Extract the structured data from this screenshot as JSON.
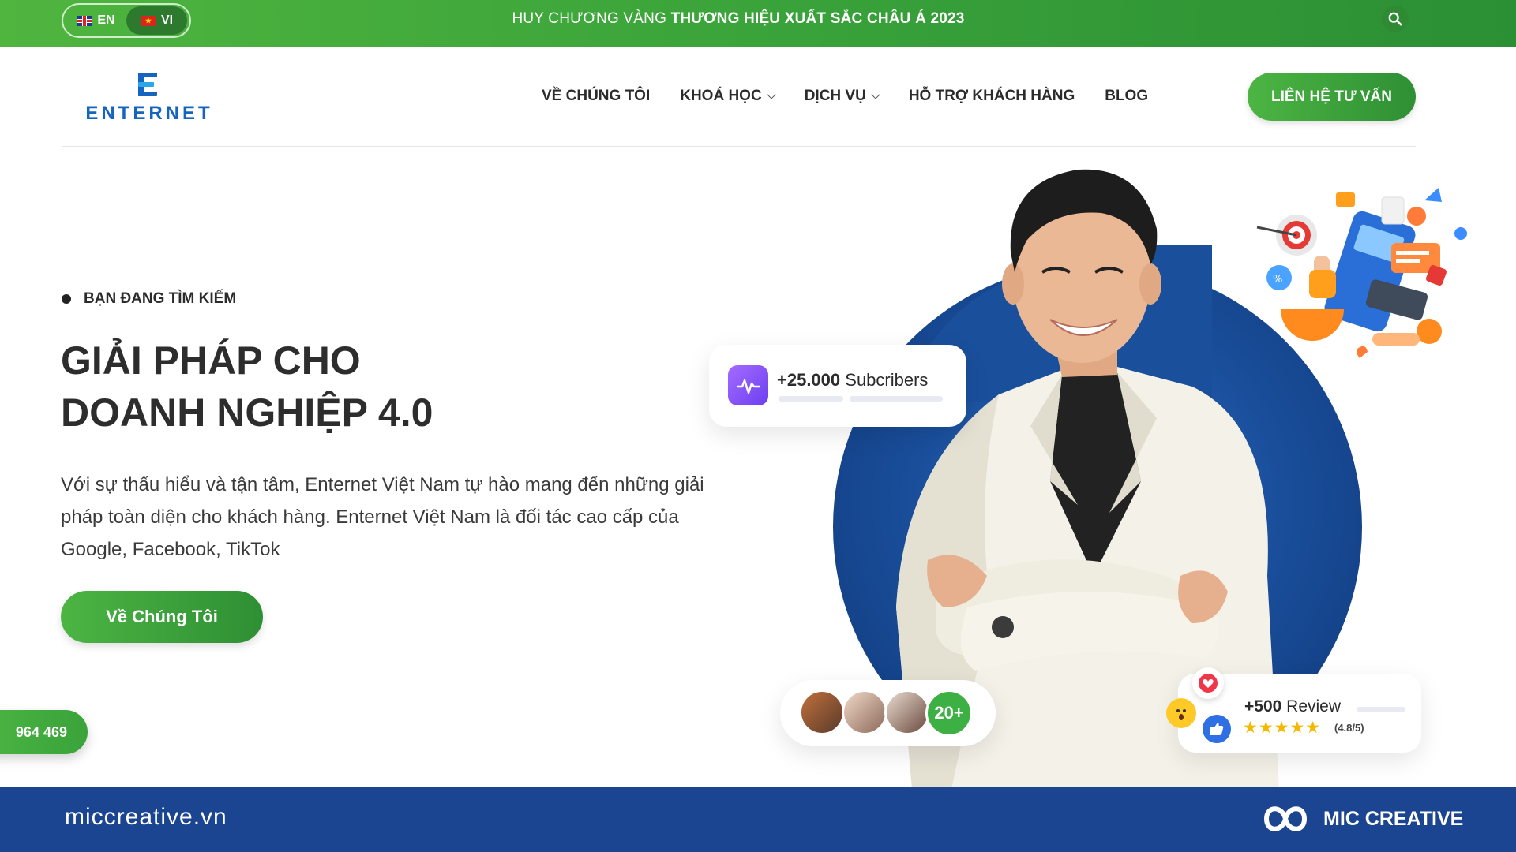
{
  "topbar": {
    "languages": [
      {
        "code": "EN",
        "active": false
      },
      {
        "code": "VI",
        "active": true
      }
    ],
    "announcement_prefix": "HUY CHƯƠNG VÀNG",
    "announcement_bold": "THƯƠNG HIỆU XUẤT SẮC CHÂU Á 2023",
    "search_icon": "search-icon",
    "colors": {
      "green_start": "#4fb53f",
      "green_end": "#2b8f34"
    }
  },
  "header": {
    "logo_text": "ENTERNET",
    "nav": [
      {
        "label": "VỀ CHÚNG TÔI",
        "has_dropdown": false
      },
      {
        "label": "KHOÁ HỌC",
        "has_dropdown": true
      },
      {
        "label": "DỊCH VỤ",
        "has_dropdown": true
      },
      {
        "label": "HỖ TRỢ KHÁCH HÀNG",
        "has_dropdown": false
      },
      {
        "label": "BLOG",
        "has_dropdown": false
      }
    ],
    "cta_label": "LIÊN HỆ TƯ VẤN"
  },
  "hero": {
    "eyebrow": "BẠN ĐANG TÌM KIẾM",
    "title_line1": "GIẢI PHÁP CHO",
    "title_line2": "DOANH NGHIỆP 4.0",
    "description": "Với sự thấu hiểu và tận tâm, Enternet Việt Nam tự hào mang đến những giải pháp toàn diện cho khách hàng. Enternet Việt Nam là đối tác cao cấp của Google, Facebook, TikTok",
    "button_label": "Về Chúng Tôi",
    "phone_partial": "964 469"
  },
  "cards": {
    "subscribers_count": "+25.000",
    "subscribers_label": "Subcribers",
    "avatars_count": "20+",
    "review_count": "+500",
    "review_label": "Review",
    "review_stars": "★★★★★",
    "review_rating": "(4.8/5)"
  },
  "footer": {
    "site": "miccreative.vn",
    "brand": "MIC CREATIVE"
  },
  "colors": {
    "accent_green": "#3aa33a",
    "brand_blue": "#1565c0",
    "footer_blue": "#1c4591",
    "circle_blue": "#1a4f9c"
  }
}
